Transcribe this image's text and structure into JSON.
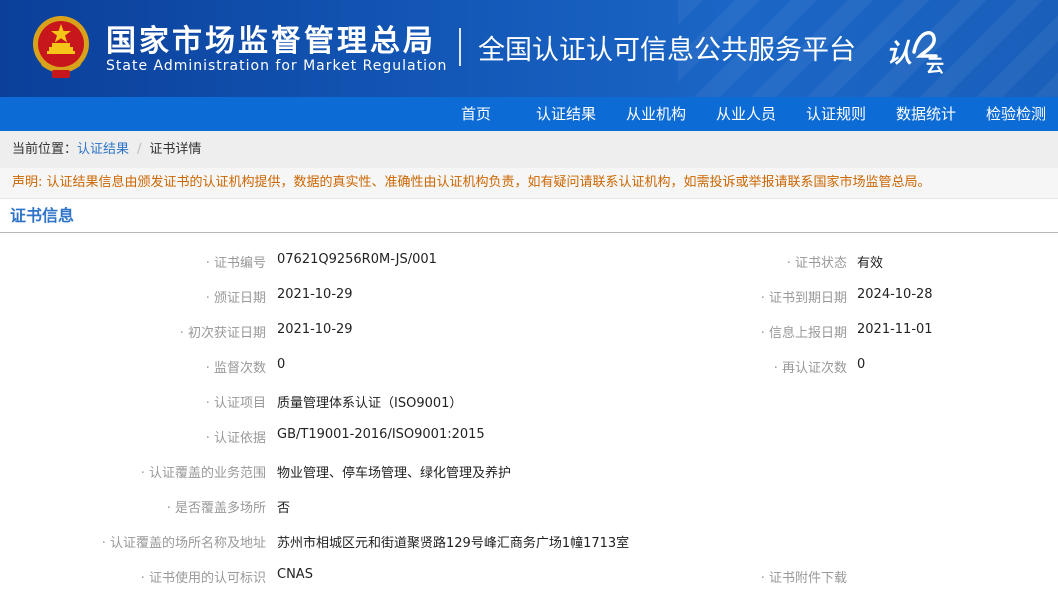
{
  "header": {
    "agency_cn": "国家市场监督管理总局",
    "agency_en": "State Administration  for  Market Regulation",
    "platform_title": "全国认证认可信息公共服务平台",
    "logo_text": "认云"
  },
  "nav": {
    "items": [
      {
        "label": "首页"
      },
      {
        "label": "认证结果"
      },
      {
        "label": "从业机构"
      },
      {
        "label": "从业人员"
      },
      {
        "label": "认证规则"
      },
      {
        "label": "数据统计"
      },
      {
        "label": "检验检测"
      }
    ]
  },
  "breadcrumb": {
    "prefix": "当前位置：",
    "items": [
      "认证结果",
      "证书详情"
    ],
    "separator": "/"
  },
  "notice": "声明: 认证结果信息由颁发证书的认证机构提供，数据的真实性、准确性由认证机构负责，如有疑问请联系认证机构，如需投诉或举报请联系国家市场监管总局。",
  "section_title": "证书信息",
  "bullet": "·",
  "fields": {
    "cert_no": {
      "label": "证书编号",
      "value": "07621Q9256R0M-JS/001"
    },
    "status": {
      "label": "证书状态",
      "value": "有效"
    },
    "issue_date": {
      "label": "颁证日期",
      "value": "2021-10-29"
    },
    "expire_date": {
      "label": "证书到期日期",
      "value": "2024-10-28"
    },
    "first_date": {
      "label": "初次获证日期",
      "value": "2021-10-29"
    },
    "report_date": {
      "label": "信息上报日期",
      "value": "2021-11-01"
    },
    "supervision_count": {
      "label": "监督次数",
      "value": "0"
    },
    "recert_count": {
      "label": "再认证次数",
      "value": "0"
    },
    "project": {
      "label": "认证项目",
      "value": "质量管理体系认证（ISO9001）"
    },
    "basis": {
      "label": "认证依据",
      "value": "GB/T19001-2016/ISO9001:2015"
    },
    "scope": {
      "label": "认证覆盖的业务范围",
      "value": "物业管理、停车场管理、绿化管理及养护"
    },
    "multi_site": {
      "label": "是否覆盖多场所",
      "value": "否"
    },
    "site_address": {
      "label": "认证覆盖的场所名称及地址",
      "value": "苏州市相城区元和街道聚贤路129号峰汇商务广场1幢1713室"
    },
    "accreditation_mark": {
      "label": "证书使用的认可标识",
      "value": "CNAS"
    },
    "attachment": {
      "label": "证书附件下载",
      "value": ""
    }
  },
  "colors": {
    "header_bg": "#1459b8",
    "nav_bg": "#0c6bd4",
    "link": "#2f74c9",
    "notice": "#cc6600",
    "label": "#999999"
  }
}
